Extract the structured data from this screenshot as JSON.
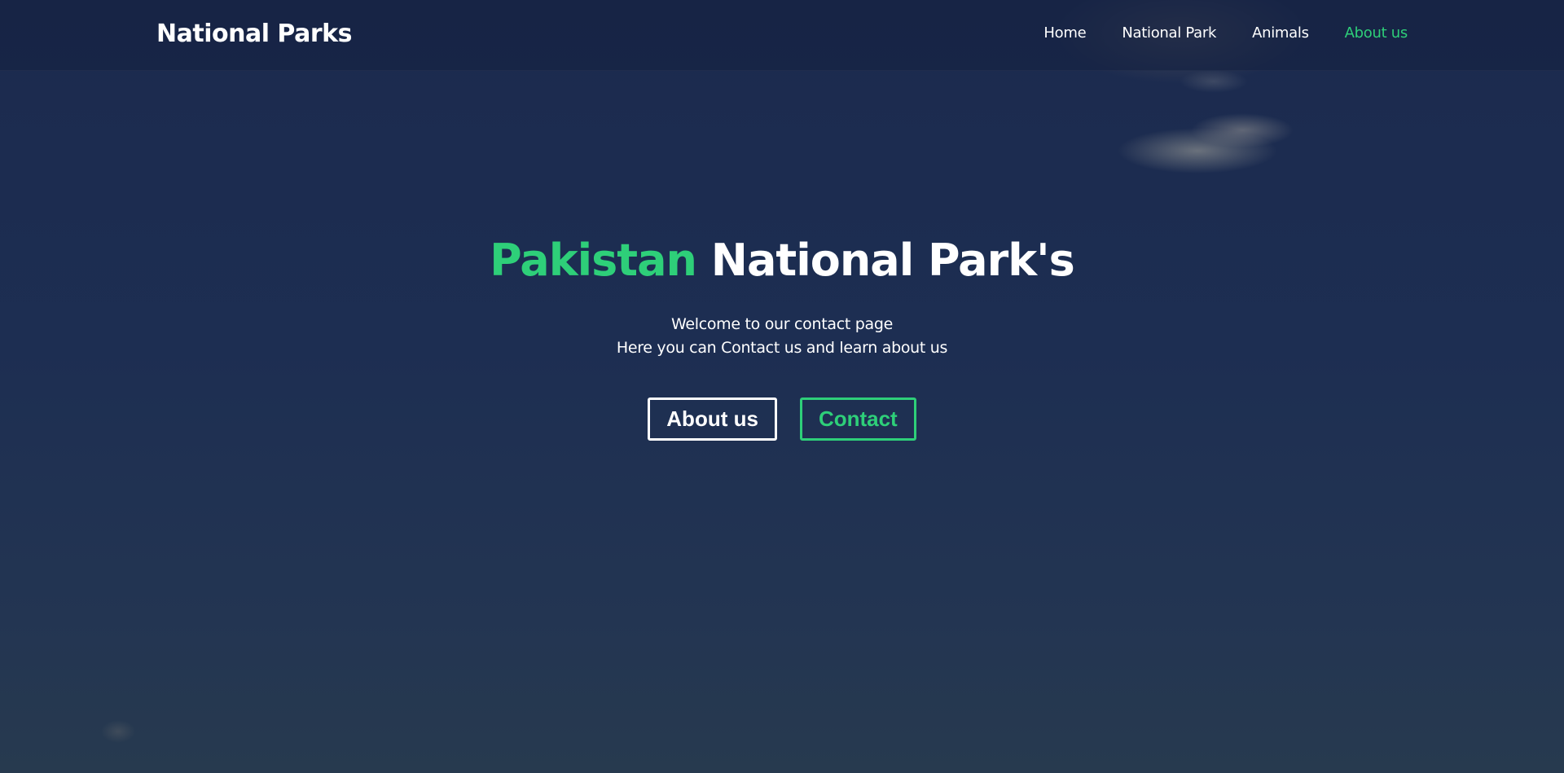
{
  "header": {
    "brand": "National Parks",
    "nav": [
      {
        "label": "Home",
        "active": false
      },
      {
        "label": "National Park",
        "active": false
      },
      {
        "label": "Animals",
        "active": false
      },
      {
        "label": "About us",
        "active": true
      }
    ]
  },
  "hero": {
    "title_accent": "Pakistan",
    "title_rest": "National Park's",
    "subtitle_line1": "Welcome to our contact page",
    "subtitle_line2": "Here you can Contact us and learn about us",
    "buttons": [
      {
        "label": "About us"
      },
      {
        "label": "Contact"
      }
    ]
  },
  "colors": {
    "accent": "#2ecf79",
    "navbar": "#162242",
    "background": "#1d2e52",
    "text": "#ffffff"
  }
}
